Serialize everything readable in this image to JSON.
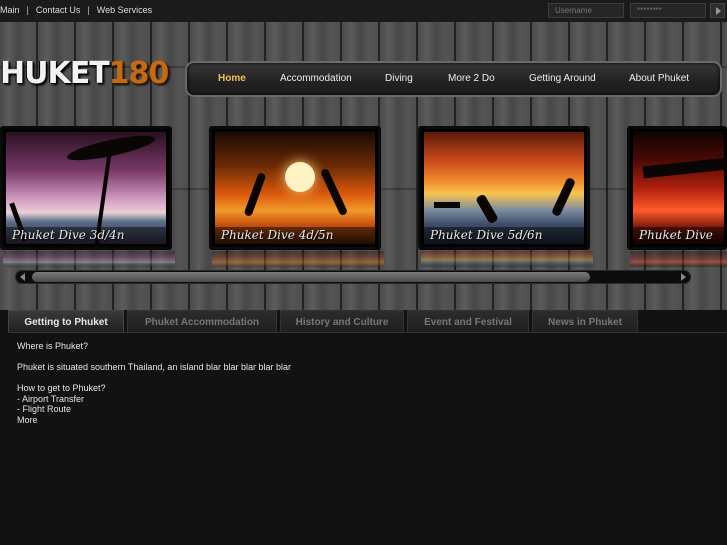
{
  "topbar": {
    "links": [
      "Main",
      "Contact Us",
      "Web Services"
    ],
    "username_placeholder": "Username",
    "password_placeholder": "********"
  },
  "logo": {
    "part1": "HUKET",
    "part2": "180"
  },
  "nav": [
    "Home",
    "Accommodation",
    "Diving",
    "More 2 Do",
    "Getting Around",
    "About Phuket"
  ],
  "colors": {
    "active_nav": "#f3c24a",
    "logo_accent": "#c46a10"
  },
  "slides": [
    {
      "caption": "Phuket Dive 3d/4n"
    },
    {
      "caption": "Phuket Dive 4d/5n"
    },
    {
      "caption": "Phuket Dive 5d/6n"
    },
    {
      "caption": "Phuket Dive"
    }
  ],
  "tabs": [
    "Getting to Phuket",
    "Phuket Accommodation",
    "History and Culture",
    "Event and Festival",
    "News in Phuket"
  ],
  "content": {
    "q1": "Where is Phuket?",
    "a1": "Phuket is situated southern Thailand, an island blar blar blar blar blar",
    "q2": "How to get to Phuket?",
    "item1": "- Airport Transfer",
    "item2": "- Flight Route",
    "more": "More"
  }
}
